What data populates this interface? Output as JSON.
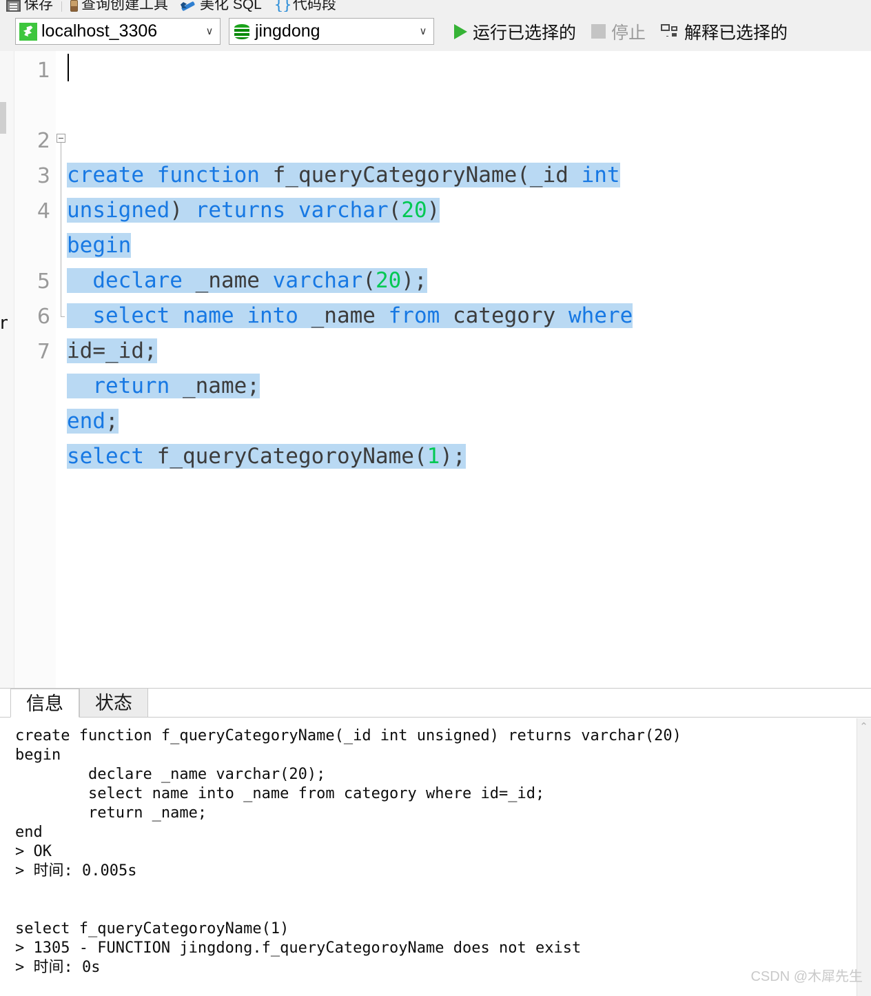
{
  "toolbar": {
    "items": [
      {
        "icon": "save-icon",
        "label": "保存"
      },
      {
        "icon": "query-builder-icon",
        "label": "查询创建工具"
      },
      {
        "icon": "beautify-icon",
        "label": "美化 SQL"
      },
      {
        "icon": "snippet-icon",
        "label": "代码段"
      }
    ]
  },
  "connection_bar": {
    "connection": {
      "icon": "mysql-dolphin-icon",
      "value": "localhost_3306",
      "caret": "∨"
    },
    "database": {
      "icon": "database-cylinder-icon",
      "value": "jingdong",
      "caret": "∨"
    },
    "run_selected_label": "运行已选择的",
    "stop_label": "停止",
    "explain_selected_label": "解释已选择的"
  },
  "editor": {
    "line_numbers": [
      "1",
      "2",
      "3",
      "4",
      "5",
      "6",
      "7"
    ],
    "fold_marker": "−",
    "lines": [
      {
        "number": "1",
        "visual_rows": [
          {
            "tokens": [
              {
                "t": "create",
                "c": "k"
              },
              {
                "t": " ",
                "c": "p"
              },
              {
                "t": "function",
                "c": "k"
              },
              {
                "t": " ",
                "c": "p"
              },
              {
                "t": "f_queryCategoryName",
                "c": "id"
              },
              {
                "t": "(",
                "c": "p"
              },
              {
                "t": "_id",
                "c": "id"
              },
              {
                "t": " ",
                "c": "p"
              },
              {
                "t": "int",
                "c": "k"
              }
            ]
          },
          {
            "tokens": [
              {
                "t": "unsigned",
                "c": "k"
              },
              {
                "t": ")",
                "c": "p"
              },
              {
                "t": " ",
                "c": "p"
              },
              {
                "t": "returns",
                "c": "k"
              },
              {
                "t": " ",
                "c": "p"
              },
              {
                "t": "varchar",
                "c": "k"
              },
              {
                "t": "(",
                "c": "p"
              },
              {
                "t": "20",
                "c": "n"
              },
              {
                "t": ")",
                "c": "p"
              }
            ]
          }
        ]
      },
      {
        "number": "2",
        "visual_rows": [
          {
            "tokens": [
              {
                "t": "begin",
                "c": "k"
              }
            ]
          }
        ]
      },
      {
        "number": "3",
        "visual_rows": [
          {
            "tokens": [
              {
                "t": "  ",
                "c": "p"
              },
              {
                "t": "declare",
                "c": "k"
              },
              {
                "t": " ",
                "c": "p"
              },
              {
                "t": "_name",
                "c": "id"
              },
              {
                "t": " ",
                "c": "p"
              },
              {
                "t": "varchar",
                "c": "k"
              },
              {
                "t": "(",
                "c": "p"
              },
              {
                "t": "20",
                "c": "n"
              },
              {
                "t": ");",
                "c": "p"
              }
            ]
          }
        ]
      },
      {
        "number": "4",
        "visual_rows": [
          {
            "tokens": [
              {
                "t": "  ",
                "c": "p"
              },
              {
                "t": "select",
                "c": "k"
              },
              {
                "t": " ",
                "c": "p"
              },
              {
                "t": "name",
                "c": "k"
              },
              {
                "t": " ",
                "c": "p"
              },
              {
                "t": "into",
                "c": "k"
              },
              {
                "t": " ",
                "c": "p"
              },
              {
                "t": "_name",
                "c": "id"
              },
              {
                "t": " ",
                "c": "p"
              },
              {
                "t": "from",
                "c": "k"
              },
              {
                "t": " ",
                "c": "p"
              },
              {
                "t": "category",
                "c": "id"
              },
              {
                "t": " ",
                "c": "p"
              },
              {
                "t": "where",
                "c": "k"
              }
            ]
          },
          {
            "tokens": [
              {
                "t": "id=_id;",
                "c": "id"
              }
            ]
          }
        ]
      },
      {
        "number": "5",
        "visual_rows": [
          {
            "tokens": [
              {
                "t": "  ",
                "c": "p"
              },
              {
                "t": "return",
                "c": "k"
              },
              {
                "t": " ",
                "c": "p"
              },
              {
                "t": "_name;",
                "c": "id"
              }
            ]
          }
        ]
      },
      {
        "number": "6",
        "visual_rows": [
          {
            "tokens": [
              {
                "t": "end",
                "c": "k"
              },
              {
                "t": ";",
                "c": "p"
              }
            ]
          }
        ]
      },
      {
        "number": "7",
        "visual_rows": [
          {
            "tokens": [
              {
                "t": "select",
                "c": "k"
              },
              {
                "t": " ",
                "c": "p"
              },
              {
                "t": "f_queryCategoroyName",
                "c": "id"
              },
              {
                "t": "(",
                "c": "p"
              },
              {
                "t": "1",
                "c": "n"
              },
              {
                "t": ");",
                "c": "p"
              }
            ]
          }
        ]
      }
    ],
    "selection_color": "#b9d9f3",
    "keyword_color": "#1778e3",
    "number_color": "#00c853",
    "identifier_color": "#3c3c3c"
  },
  "output_panel": {
    "tabs": [
      {
        "label": "信息",
        "active": true
      },
      {
        "label": "状态",
        "active": false
      }
    ],
    "console_text": "create function f_queryCategoryName(_id int unsigned) returns varchar(20)\nbegin\n\tdeclare _name varchar(20);\n\tselect name into _name from category where id=_id;\n\treturn _name;\nend\n> OK\n> 时间: 0.005s\n\n\nselect f_queryCategoroyName(1)\n> 1305 - FUNCTION jingdong.f_queryCategoroyName does not exist\n> 时间: 0s",
    "scroll_up_arrow": "⌃"
  },
  "watermark": "CSDN @木犀先生"
}
